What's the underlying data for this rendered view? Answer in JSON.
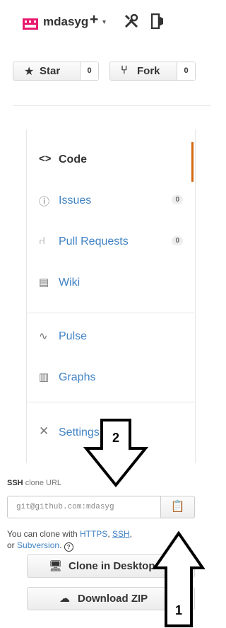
{
  "header": {
    "username": "mdasyg",
    "icons": [
      "avatar-icon",
      "plus-icon",
      "caret-down-icon",
      "tools-icon",
      "sign-out-icon"
    ]
  },
  "actions": {
    "star": {
      "label": "Star",
      "count": "0"
    },
    "fork": {
      "label": "Fork",
      "count": "0"
    }
  },
  "nav": {
    "items": [
      {
        "label": "Code",
        "icon": "code-icon",
        "selected": true
      },
      {
        "label": "Issues",
        "icon": "issue-icon",
        "count": "0"
      },
      {
        "label": "Pull Requests",
        "icon": "pull-request-icon",
        "count": "0"
      },
      {
        "label": "Wiki",
        "icon": "book-icon"
      },
      {
        "label": "Pulse",
        "icon": "pulse-icon"
      },
      {
        "label": "Graphs",
        "icon": "graph-icon"
      },
      {
        "label": "Settings",
        "icon": "tools-icon"
      }
    ]
  },
  "clone": {
    "title_bold": "SSH",
    "title_rest": "clone URL",
    "url": "git@github.com:mdasyg",
    "help": {
      "prefix": "You can clone with ",
      "https": "HTTPS",
      "comma1": ", ",
      "ssh": "SSH",
      "comma2": ",",
      "or": "or ",
      "subversion": "Subversion",
      "period": "."
    },
    "desktop_label": "Clone in Desktop",
    "zip_label": "Download ZIP"
  },
  "annotations": {
    "arrow_1": "1",
    "arrow_2": "2"
  },
  "colors": {
    "link": "#4183c4",
    "selected_bar": "#d26911",
    "avatar": "#e8196e"
  }
}
